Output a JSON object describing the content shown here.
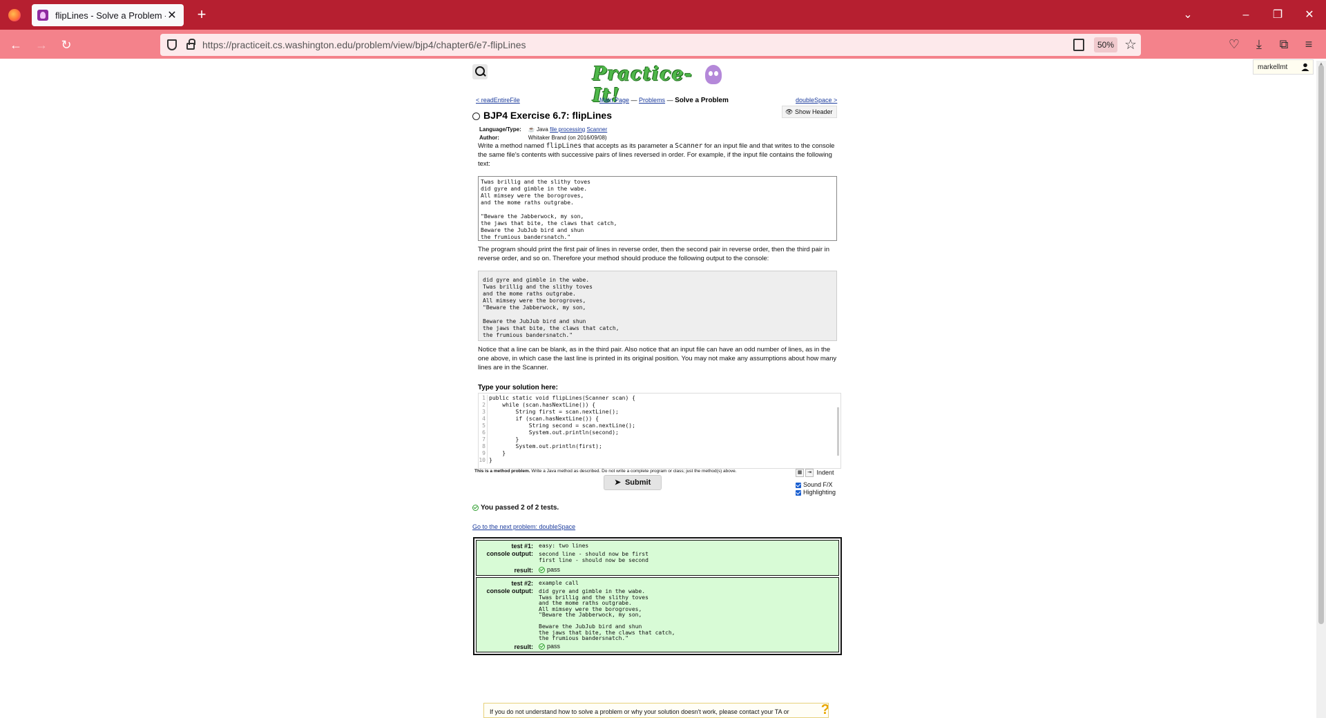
{
  "browser": {
    "tab_title": "flipLines - Solve a Problem - Pr",
    "url": "https://practiceit.cs.washington.edu/problem/view/bjp4/chapter6/e7-flipLines",
    "zoom": "50%",
    "user": "markellmt"
  },
  "header": {
    "logo_text": "Practice-It!",
    "prev_link": "< readEntireFile",
    "next_link": "doubleSpace >",
    "crumb_main": "Main Page",
    "crumb_sep1": " — ",
    "crumb_problems": "Problems",
    "crumb_sep2": " — ",
    "crumb_current": "Solve a Problem",
    "show_header": "Show Header"
  },
  "problem": {
    "title": "BJP4 Exercise 6.7: flipLines",
    "lang_label": "Language/Type:",
    "lang_value": "Java",
    "tag1": "file processing",
    "tag2": "Scanner",
    "author_label": "Author:",
    "author_value": "Whitaker Brand (on 2016/09/08)",
    "desc1_a": "Write a method named ",
    "desc1_code1": "flipLines",
    "desc1_b": " that accepts as its parameter a ",
    "desc1_code2": "Scanner",
    "desc1_c": " for an input file and that writes to the console the same file's contents with successive pairs of lines reversed in order. For example, if the input file contains the following text:",
    "input_text": "Twas brillig and the slithy toves\ndid gyre and gimble in the wabe.\nAll mimsey were the borogroves,\nand the mome raths outgrabe.\n\n\"Beware the Jabberwock, my son,\nthe jaws that bite, the claws that catch,\nBeware the JubJub bird and shun\nthe frumious bandersnatch.\"",
    "desc2": "The program should print the first pair of lines in reverse order, then the second pair in reverse order, then the third pair in reverse order, and so on. Therefore your method should produce the following output to the console:",
    "output_text": "did gyre and gimble in the wabe.\nTwas brillig and the slithy toves\nand the mome raths outgrabe.\nAll mimsey were the borogroves,\n\"Beware the Jabberwock, my son,\n\nBeware the JubJub bird and shun\nthe jaws that bite, the claws that catch,\nthe frumious bandersnatch.\"",
    "desc3": "Notice that a line can be blank, as in the third pair. Also notice that an input file can have an odd number of lines, as in the one above, in which case the last line is printed in its original position. You may not make any assumptions about how many lines are in the Scanner."
  },
  "editor": {
    "label": "Type your solution here:",
    "line_numbers": "1\n2\n3\n4\n5\n6\n7\n8\n9\n10",
    "code": "public static void flipLines(Scanner scan) {\n    while (scan.hasNextLine()) {\n        String first = scan.nextLine();\n        if (scan.hasNextLine()) {\n            String second = scan.nextLine();\n            System.out.println(second);\n        }\n        System.out.println(first);\n    }\n}",
    "note_bold": "This is a method problem.",
    "note_rest": " Write a Java method as described. Do not write a complete program or class; just the method(s) above.",
    "indent_label": "Indent",
    "sound_label": "Sound F/X",
    "highlight_label": "Highlighting",
    "submit_label": "Submit"
  },
  "results": {
    "summary": "You passed 2 of 2 tests.",
    "next_problem": "Go to the next problem: doubleSpace",
    "tests": [
      {
        "test_label": "test #1:",
        "test_value": "easy: two lines",
        "console_label": "console output:",
        "console_value": "second line - should now be first\nfirst line - should now be second",
        "result_label": "result:",
        "result_value": "pass"
      },
      {
        "test_label": "test #2:",
        "test_value": "example call",
        "console_label": "console output:",
        "console_value": "did gyre and gimble in the wabe.\nTwas brillig and the slithy toves\nand the mome raths outgrabe.\nAll mimsey were the borogroves,\n\"Beware the Jabberwock, my son,\n\nBeware the JubJub bird and shun\nthe jaws that bite, the claws that catch,\nthe frumious bandersnatch.\"",
        "result_label": "result:",
        "result_value": "pass"
      }
    ]
  },
  "help": {
    "text": "If you do not understand how to solve a problem or why your solution doesn't work, please contact your TA or"
  }
}
